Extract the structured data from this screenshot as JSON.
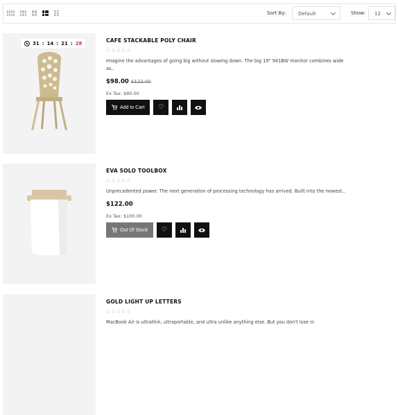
{
  "toolbar": {
    "views": [
      "grid-4",
      "grid-3",
      "grid-2",
      "list",
      "list-small"
    ],
    "sort_label": "Sort By:",
    "sort_value": "Default",
    "show_label": "Show:",
    "show_value": "12"
  },
  "products": [
    {
      "name": "CAFE STACKABLE POLY CHAIR",
      "stars": "☆☆☆☆☆",
      "description": "Imagine the advantages of going big without slowing down. The big 19\" 941BW monitor combines wide as..",
      "price": "$98.00",
      "old_price": "$122.00",
      "ex_tax": "Ex Tax: $80.00",
      "cart_label": "Add to Cart",
      "timer": {
        "days": "31",
        "hours": "14",
        "minutes": "21",
        "seconds": "28"
      }
    },
    {
      "name": "EVA SOLO TOOLBOX",
      "stars": "☆☆☆☆☆",
      "description": "Unprecedented power. The next generation of processing technology has arrived. Built into the newest..",
      "price": "$122.00",
      "ex_tax": "Ex Tax: $100.00",
      "cart_label": "Out Of Stock"
    },
    {
      "name": "GOLD LIGHT UP LETTERS",
      "stars": "☆☆☆☆☆",
      "description": "MacBook Air is ultrathin, ultraportable, and ultra unlike anything else. But you don't lose in"
    }
  ]
}
